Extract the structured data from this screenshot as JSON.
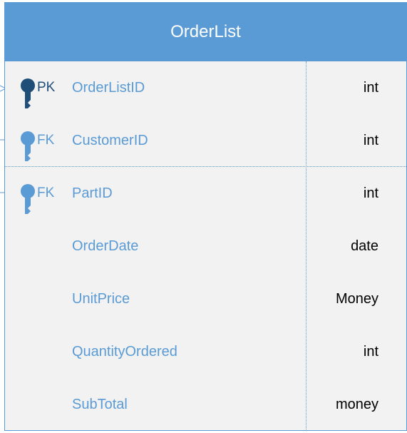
{
  "entity": {
    "title": "OrderList",
    "fields": [
      {
        "key": "PK",
        "name": "OrderListID",
        "type": "int",
        "key_icon": "key-icon",
        "key_color": "#1f4e79"
      },
      {
        "key": "FK",
        "name": "CustomerID",
        "type": "int",
        "key_icon": "key-icon",
        "key_color": "#5b9bd5"
      },
      {
        "key": "FK",
        "name": "PartID",
        "type": "int",
        "key_icon": "key-icon",
        "key_color": "#5b9bd5"
      },
      {
        "key": "",
        "name": "OrderDate",
        "type": "date"
      },
      {
        "key": "",
        "name": "UnitPrice",
        "type": "Money"
      },
      {
        "key": "",
        "name": "QuantityOrdered",
        "type": "int"
      },
      {
        "key": "",
        "name": "SubTotal",
        "type": "money"
      }
    ]
  },
  "colors": {
    "header": "#5b9bd5",
    "body": "#f2f2f2",
    "field_name": "#5b9bd5",
    "pk": "#1f4e79",
    "fk": "#5b9bd5"
  }
}
